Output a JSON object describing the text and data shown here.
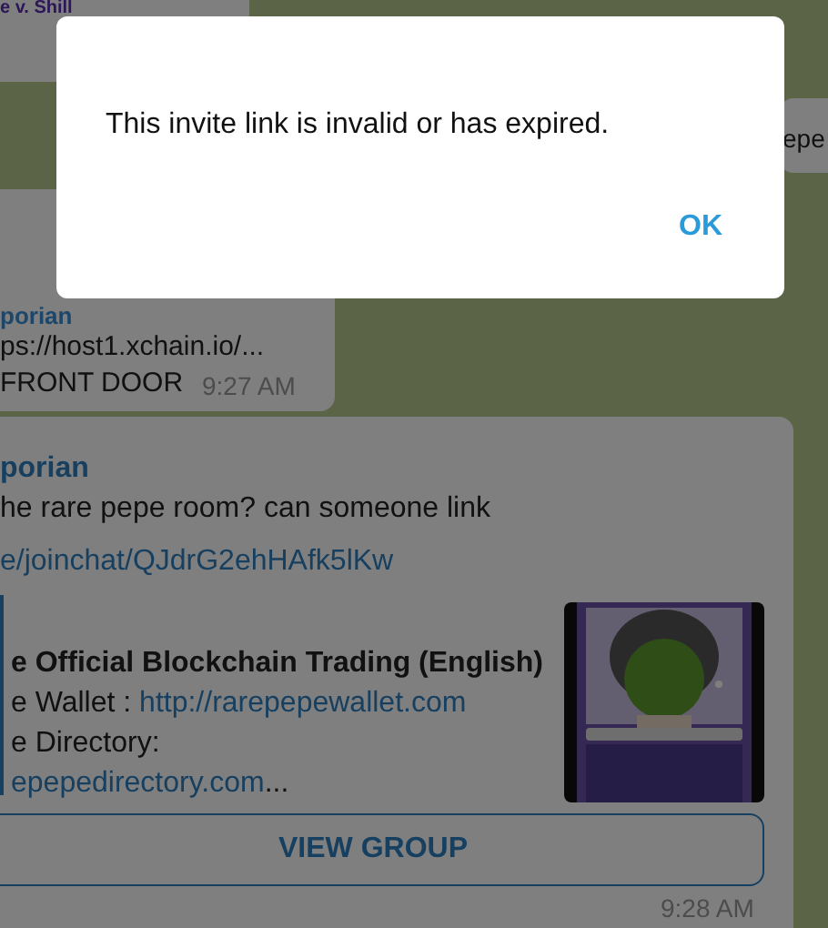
{
  "chat": {
    "message_1": {
      "sender": "e v. Shill"
    },
    "message_2": {
      "text": "epe"
    },
    "message_3": {
      "sender": "porian",
      "link": "ps://host1.xchain.io/...",
      "text": "FRONT DOOR",
      "time": "9:27 AM"
    },
    "message_4": {
      "sender": "porian",
      "text": "he rare pepe room? can someone link",
      "link": "e/joinchat/QJdrG2ehHAfk5lKw",
      "preview": {
        "title": "e Official Blockchain Trading (English)",
        "wallet_label": "e Wallet : ",
        "wallet_link": "http://rarepepewallet.com",
        "directory_label": "e Directory:",
        "directory_link": "epepedirectory.com",
        "ellipsis": "..."
      },
      "button": "VIEW GROUP",
      "time": "9:28 AM"
    }
  },
  "dialog": {
    "message": "This invite link is invalid or has expired.",
    "button": "OK"
  }
}
